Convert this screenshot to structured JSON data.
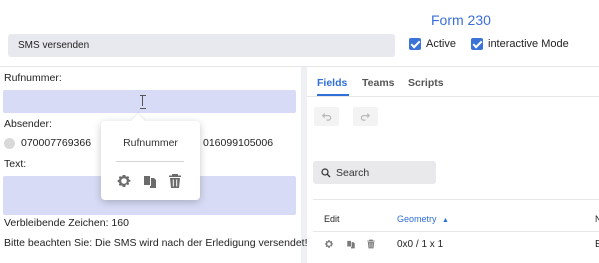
{
  "header": {
    "form_title": "Form 230",
    "name_value": "SMS versenden",
    "active_label": "Active",
    "interactive_label": "interactive Mode"
  },
  "left": {
    "phone_label": "Rufnummer:",
    "sender_label": "Absender:",
    "sender_option_1": "070007769366",
    "sender_option_2": "016099105006",
    "text_label": "Text:",
    "remaining_label": "Verbleibende Zeichen:",
    "remaining_count": "160",
    "notice": "Bitte beachten Sie: Die SMS wird nach der Erledigung versendet!"
  },
  "popover": {
    "title": "Rufnummer",
    "icons": [
      "gear-icon",
      "copy-icon",
      "trash-icon"
    ]
  },
  "right": {
    "tabs": [
      "Fields",
      "Teams",
      "Scripts"
    ],
    "active_tab": "Fields",
    "search_placeholder": "Search",
    "columns": [
      "Edit",
      "Geometry"
    ],
    "column_partial": "N",
    "sort_indicator": "▲",
    "rows": [
      {
        "geometry": "0x0 / 1 x 1",
        "trailing": "E"
      }
    ]
  },
  "colors": {
    "accent": "#2f6fd8",
    "input_fill": "#d7dbf5",
    "checkbox": "#3b73d6"
  }
}
